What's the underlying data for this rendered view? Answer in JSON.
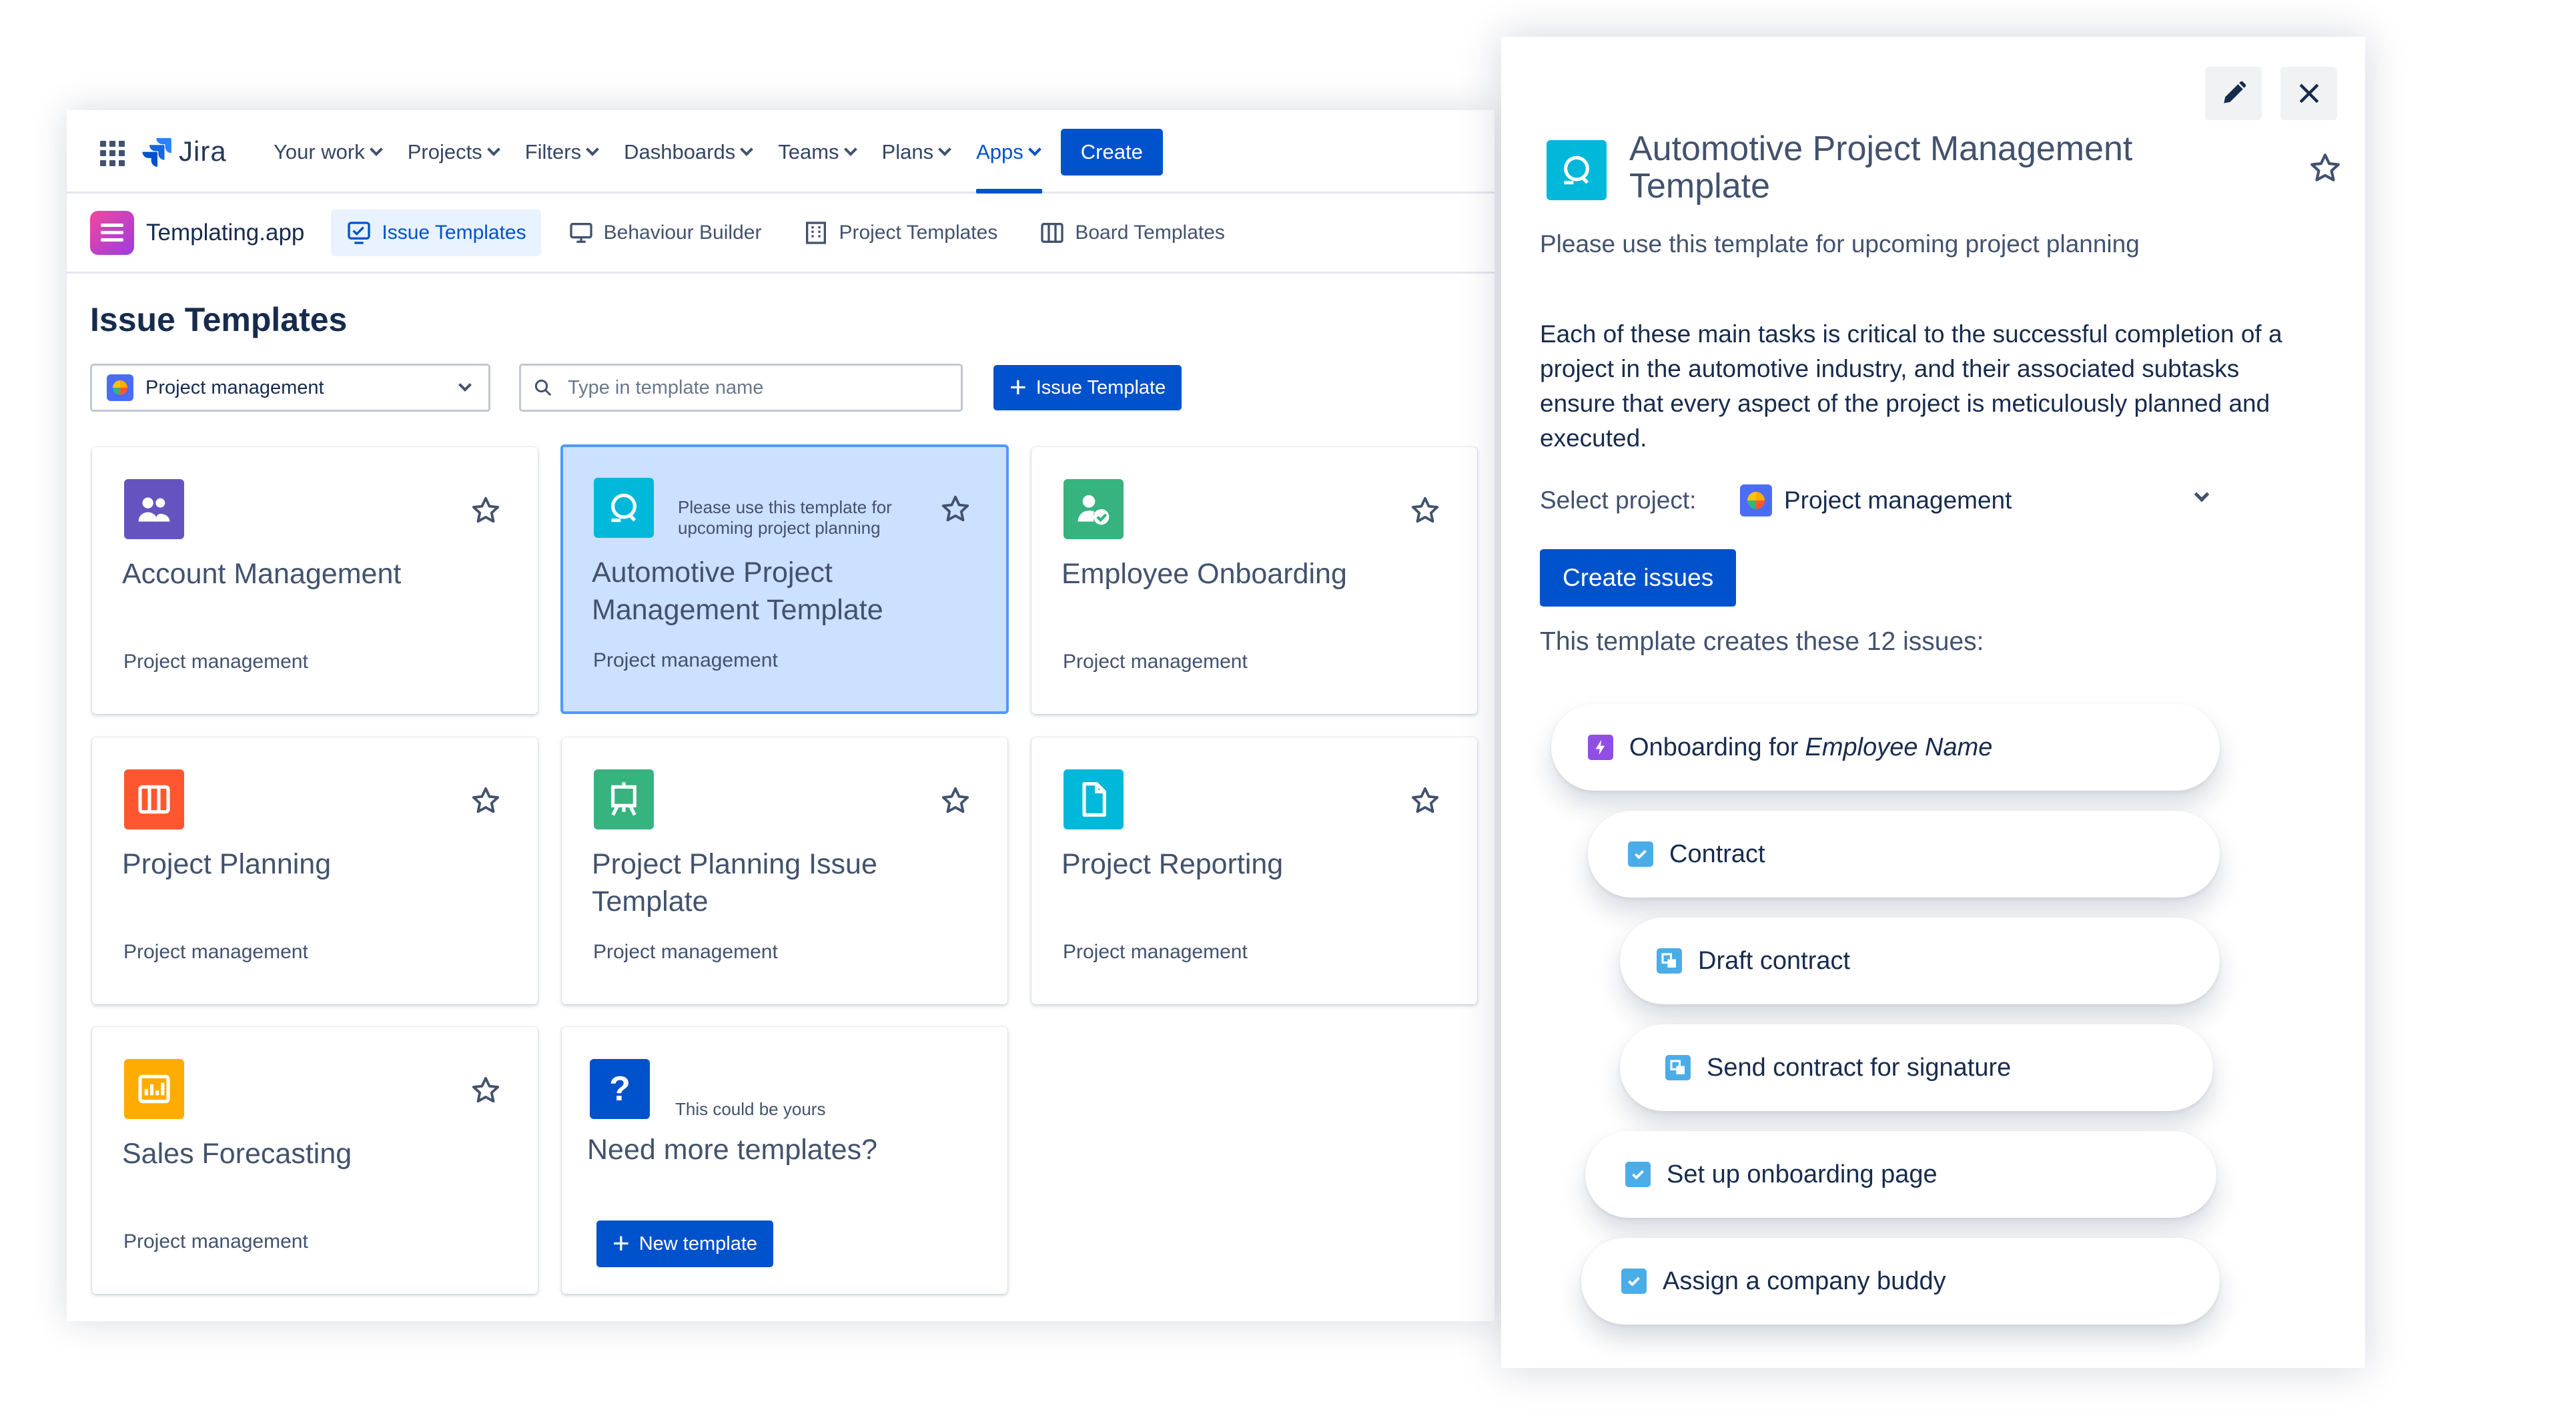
{
  "nav": {
    "product": "Jira",
    "items": [
      {
        "label": "Your work"
      },
      {
        "label": "Projects"
      },
      {
        "label": "Filters"
      },
      {
        "label": "Dashboards"
      },
      {
        "label": "Teams"
      },
      {
        "label": "Plans"
      },
      {
        "label": "Apps"
      }
    ],
    "create_label": "Create"
  },
  "subnav": {
    "app_name": "Templating.app",
    "tabs": [
      {
        "label": "Issue Templates"
      },
      {
        "label": "Behaviour Builder"
      },
      {
        "label": "Project Templates"
      },
      {
        "label": "Board Templates"
      }
    ]
  },
  "page": {
    "title": "Issue Templates",
    "project_select": "Project management",
    "search_placeholder": "Type in template name",
    "add_template_label": "Issue Template"
  },
  "cards": [
    {
      "title": "Account Management",
      "subtitle": "Project management",
      "icon": "people-icon",
      "color": "#6554c0"
    },
    {
      "title": "Automotive Project Management Template",
      "subtitle": "Project management",
      "description": "Please use this template for upcoming project planning",
      "icon": "automation-icon",
      "color": "#00b8d9"
    },
    {
      "title": "Employee Onboarding",
      "subtitle": "Project management",
      "icon": "user-check-icon",
      "color": "#36b37e"
    },
    {
      "title": "Project Planning",
      "subtitle": "Project management",
      "icon": "columns-icon",
      "color": "#ff5630"
    },
    {
      "title": "Project Planning Issue Template",
      "subtitle": "Project management",
      "icon": "easel-icon",
      "color": "#36b37e"
    },
    {
      "title": "Project Reporting",
      "subtitle": "Project management",
      "icon": "document-icon",
      "color": "#00b8d9"
    },
    {
      "title": "Sales Forecasting",
      "subtitle": "Project management",
      "icon": "chart-icon",
      "color": "#ffab00"
    }
  ],
  "promo": {
    "icon_text": "?",
    "small": "This could be yours",
    "title": "Need more templates?",
    "button": "New template"
  },
  "panel": {
    "title": "Automotive Project Management Template",
    "subtitle": "Please use this template for upcoming project planning",
    "description": "Each of these main tasks is critical to the successful completion of a project in the automotive industry, and their associated subtasks ensure that every aspect of the project is meticulously planned and executed.",
    "select_label": "Select project:",
    "select_value": "Project management",
    "create_button": "Create issues",
    "count_text": "This template creates these 12 issues:",
    "issues": [
      {
        "prefix": "Onboarding for",
        "italic": "Employee Name",
        "type": "epic"
      },
      {
        "prefix": "Contract",
        "italic": "",
        "type": "task"
      },
      {
        "prefix": "Draft contract",
        "italic": "",
        "type": "subtask"
      },
      {
        "prefix": "Send contract for signature",
        "italic": "",
        "type": "subtask"
      },
      {
        "prefix": "Set up onboarding page",
        "italic": "",
        "type": "task"
      },
      {
        "prefix": "Assign a company buddy",
        "italic": "",
        "type": "task"
      }
    ]
  },
  "colors": {
    "primary": "#0052cc",
    "selected_bg": "#cce0ff",
    "selected_border": "#4c9aff",
    "epic": "#904ee2",
    "task": "#4bade8"
  }
}
